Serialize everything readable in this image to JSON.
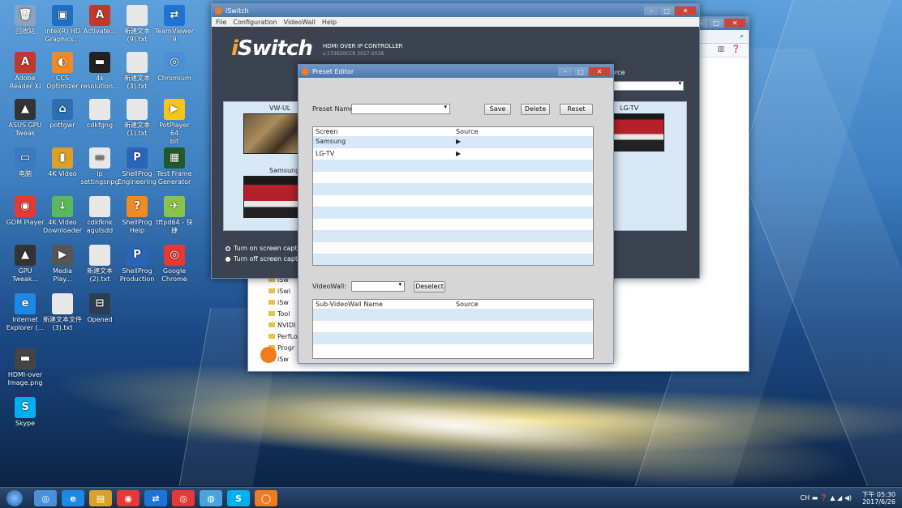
{
  "desktop_icons": [
    {
      "label": "回收站",
      "color": "#8aa4c0",
      "glyph": "🗑"
    },
    {
      "label": "Intel(R) HD\nGraphics...",
      "color": "#1f6fc4",
      "glyph": "▣"
    },
    {
      "label": "Activate...",
      "color": "#c0392b",
      "glyph": "A"
    },
    {
      "label": "新建文本\n(9).txt",
      "color": "#e8e8e8",
      "glyph": ""
    },
    {
      "label": "TeamViewer\n9",
      "color": "#1e74d6",
      "glyph": "⇄"
    },
    {
      "label": "Adobe\nReader XI",
      "color": "#c0392b",
      "glyph": "A"
    },
    {
      "label": "CCS\nOptimizer",
      "color": "#f08a24",
      "glyph": "◐"
    },
    {
      "label": "4k\nresolution...",
      "color": "#222",
      "glyph": "▬"
    },
    {
      "label": "新建文本\n(3).txt",
      "color": "#e8e8e8",
      "glyph": ""
    },
    {
      "label": "Chromium",
      "color": "#4a90d9",
      "glyph": "◎"
    },
    {
      "label": "ASUS GPU\nTweak",
      "color": "#333",
      "glyph": "▲"
    },
    {
      "label": "pottgwr",
      "color": "#2d6fb0",
      "glyph": "⌂"
    },
    {
      "label": "cdkfgng",
      "color": "#e8e8e8",
      "glyph": ""
    },
    {
      "label": "新建文本\n(1).txt",
      "color": "#e8e8e8",
      "glyph": ""
    },
    {
      "label": "PotPlayer 64\nbit",
      "color": "#f5c518",
      "glyph": "▶"
    },
    {
      "label": "电脑",
      "color": "#3c7ac0",
      "glyph": "▭"
    },
    {
      "label": "4K Video",
      "color": "#d9a02a",
      "glyph": "▮"
    },
    {
      "label": "lp\nsettingsnpg",
      "color": "#e8e8e8",
      "glyph": "▬"
    },
    {
      "label": "ShellProg\nEngineering",
      "color": "#2b65b8",
      "glyph": "P"
    },
    {
      "label": "Test Frame\nGenerator",
      "color": "#205a2a",
      "glyph": "▦"
    },
    {
      "label": "GOM Player",
      "color": "#e53935",
      "glyph": "◉"
    },
    {
      "label": "4K Video\nDownloader",
      "color": "#5cb85c",
      "glyph": "↓"
    },
    {
      "label": "cdkfknk\nagutsdd",
      "color": "#e8e8e8",
      "glyph": ""
    },
    {
      "label": "ShellProg\nHelp",
      "color": "#f08a24",
      "glyph": "?"
    },
    {
      "label": "tftpd64 - 快\n捷",
      "color": "#8bc34a",
      "glyph": "✈"
    },
    {
      "label": "GPU Tweak...",
      "color": "#333",
      "glyph": "▲"
    },
    {
      "label": "Media\nPlay...",
      "color": "#555",
      "glyph": "▶"
    },
    {
      "label": "新建文本\n(2).txt",
      "color": "#e8e8e8",
      "glyph": ""
    },
    {
      "label": "ShellProg\nProduction",
      "color": "#2b65b8",
      "glyph": "P"
    },
    {
      "label": "Google\nChrome",
      "color": "#e53935",
      "glyph": "◎"
    },
    {
      "label": "Internet\nExplorer (...",
      "color": "#1e88e5",
      "glyph": "e"
    },
    {
      "label": "新建文本文件\n(3).txt",
      "color": "#e8e8e8",
      "glyph": ""
    },
    {
      "label": "Opened",
      "color": "#2c3e50",
      "glyph": "⊟"
    },
    {
      "label": "HDMI-over\nImage.png",
      "color": "#444",
      "glyph": "▬"
    },
    {
      "label": "Skype",
      "color": "#00aff0",
      "glyph": "S"
    }
  ],
  "explorer": {
    "tree_items": [
      "iSw",
      "iSwi",
      "iSw",
      "Tool",
      "NVIDI",
      "PerfLo",
      "Progr",
      "iSw"
    ]
  },
  "iswitch": {
    "title": "iSwitch",
    "menu": [
      "File",
      "Configuration",
      "VideoWall",
      "Help"
    ],
    "logo_i": "i",
    "logo_rest": "Switch",
    "tagline": "HDMI OVER IP CONTROLLER",
    "version": "v.170620CCR 2017-2018",
    "source_label": "Source",
    "screens": [
      "VW-UL",
      "Samsung",
      "LG-TV"
    ],
    "radio_on": "Turn on screen capture",
    "radio_off": "Turn off screen capture"
  },
  "preset_editor": {
    "title": "Preset Editor",
    "preset_name_label": "Preset Name:",
    "preset_name_value": "",
    "save": "Save",
    "delete": "Delete",
    "reset": "Reset",
    "grid_headers": [
      "Screen",
      "Source"
    ],
    "grid_rows": [
      {
        "screen": "Samsung",
        "source": "▶"
      },
      {
        "screen": "LG-TV",
        "source": "▶"
      },
      {
        "screen": "",
        "source": ""
      },
      {
        "screen": "",
        "source": ""
      },
      {
        "screen": "",
        "source": ""
      },
      {
        "screen": "",
        "source": ""
      },
      {
        "screen": "",
        "source": ""
      },
      {
        "screen": "",
        "source": ""
      },
      {
        "screen": "",
        "source": ""
      },
      {
        "screen": "",
        "source": ""
      },
      {
        "screen": "",
        "source": ""
      }
    ],
    "videowall_label": "VideoWall:",
    "videowall_value": "",
    "deselect": "Deselect",
    "vw_headers": [
      "Sub-VideoWall Name",
      "Source"
    ],
    "vw_rows": [
      {
        "name": "",
        "source": ""
      },
      {
        "name": "",
        "source": ""
      },
      {
        "name": "",
        "source": ""
      },
      {
        "name": "",
        "source": ""
      }
    ]
  },
  "taskbar": {
    "apps": [
      {
        "name": "chromium-taskbar",
        "color": "#4a90d9",
        "glyph": "◎"
      },
      {
        "name": "ie-taskbar",
        "color": "#1e88e5",
        "glyph": "e"
      },
      {
        "name": "explorer-taskbar",
        "color": "#d9a02a",
        "glyph": "▤"
      },
      {
        "name": "gom-taskbar",
        "color": "#e53935",
        "glyph": "◉"
      },
      {
        "name": "teamviewer-taskbar",
        "color": "#1e74d6",
        "glyph": "⇄"
      },
      {
        "name": "chrome-taskbar",
        "color": "#e53935",
        "glyph": "◎"
      },
      {
        "name": "app-taskbar",
        "color": "#4aa3df",
        "glyph": "◍"
      },
      {
        "name": "skype-taskbar",
        "color": "#00aff0",
        "glyph": "S"
      },
      {
        "name": "iswitch-taskbar",
        "color": "#f07b20",
        "glyph": "◯"
      }
    ],
    "lang": "CH",
    "time": "下午 05:30",
    "date": "2017/6/26"
  }
}
